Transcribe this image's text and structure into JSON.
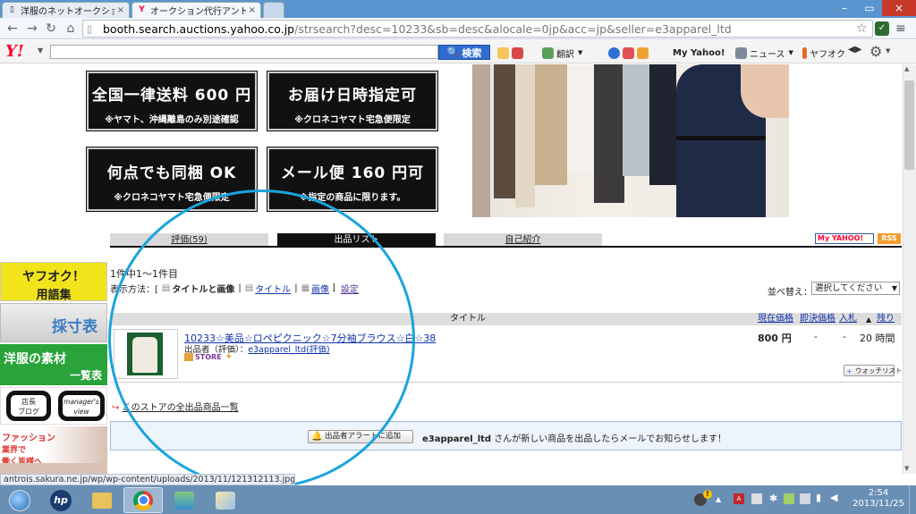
{
  "browser": {
    "tabs": [
      {
        "label": "洋服のネットオークション代行"
      },
      {
        "label": "オークション代行アントロワ (e"
      }
    ],
    "url_host": "booth.search.auctions.yahoo.co.jp",
    "url_path": "/strsearch?desc=10233&sb=desc&alocale=0jp&acc=jp&seller=e3apparel_ltd"
  },
  "yahoo_toolbar": {
    "logo": "Y!",
    "search_button": "検索",
    "translate": "翻訳",
    "myyahoo": "My Yahoo!",
    "news": "ニュース",
    "yafuoku": "ヤフオク"
  },
  "banners": [
    {
      "big": "全国一律送料 600 円",
      "small": "※ヤマト、沖縄離島のみ別途確認"
    },
    {
      "big": "お届け日時指定可",
      "small": "※クロネコヤマト宅急便限定"
    },
    {
      "big": "何点でも同梱 OK",
      "small": "※クロネコヤマト宅急便限定"
    },
    {
      "big": "メール便 160 円可",
      "small": "※指定の商品に限ります。"
    }
  ],
  "store_tabs": {
    "reviews": "評価(59)",
    "listings": "出品リスト",
    "intro": "自己紹介"
  },
  "badges": {
    "myyahoo": "My YAHOO!",
    "rss": "RSS"
  },
  "sidebar": {
    "glossary_line1": "ヤフオク！",
    "glossary_line2": "用語集",
    "size_chart": "採寸表",
    "materials_line1": "洋服の素材",
    "materials_line2": "一覧表",
    "manager_left1": "店長",
    "manager_left2": "ブログ",
    "manager_right1": "manager's",
    "manager_right2": "view",
    "fashion_line1": "ファッション",
    "fashion_line2": "業界で",
    "fashion_line3": "働く皆様へ"
  },
  "results": {
    "count": "1件中1〜1件目",
    "view_label": "表示方法：[",
    "view_title_image": "タイトルと画像",
    "view_sep1": "|",
    "view_title": "タイトル",
    "view_sep2": "|",
    "view_image": "画像",
    "view_close": "]",
    "settings": "設定",
    "sort_label": "並べ替え：",
    "sort_value": "選択してください"
  },
  "list_header": {
    "title": "タイトル",
    "price": "現在価格",
    "buynow": "即決価格",
    "bids": "入札",
    "remaining": "残り"
  },
  "item": {
    "title": "10233☆美品☆ロペピクニック☆7分袖ブラウス☆白☆38",
    "seller_prefix": "出品者（評価）：",
    "seller": "e3apparel_ltd",
    "seller_rating": "(評価)",
    "store_badge": "STORE",
    "price": "800 円",
    "buynow": "-",
    "bids": "-",
    "remaining": "20 時間",
    "watchlist": "ウォッチリスト"
  },
  "all_items_link": "このストアの全出品商品一覧",
  "alert": {
    "button": "出品者アラートに追加",
    "seller": "e3apparel_ltd",
    "message": "さんが新しい商品を出品したらメールでお知らせします！"
  },
  "status_url": "antrois.sakura.ne.jp/wp/wp-content/uploads/2013/11/121312113.jpg",
  "clock": {
    "time": "2:54",
    "date": "2013/11/25"
  },
  "colors": {
    "annotation_circle": "#1aa4dc",
    "yahoo_red": "#ff0033",
    "link": "#1133aa"
  }
}
